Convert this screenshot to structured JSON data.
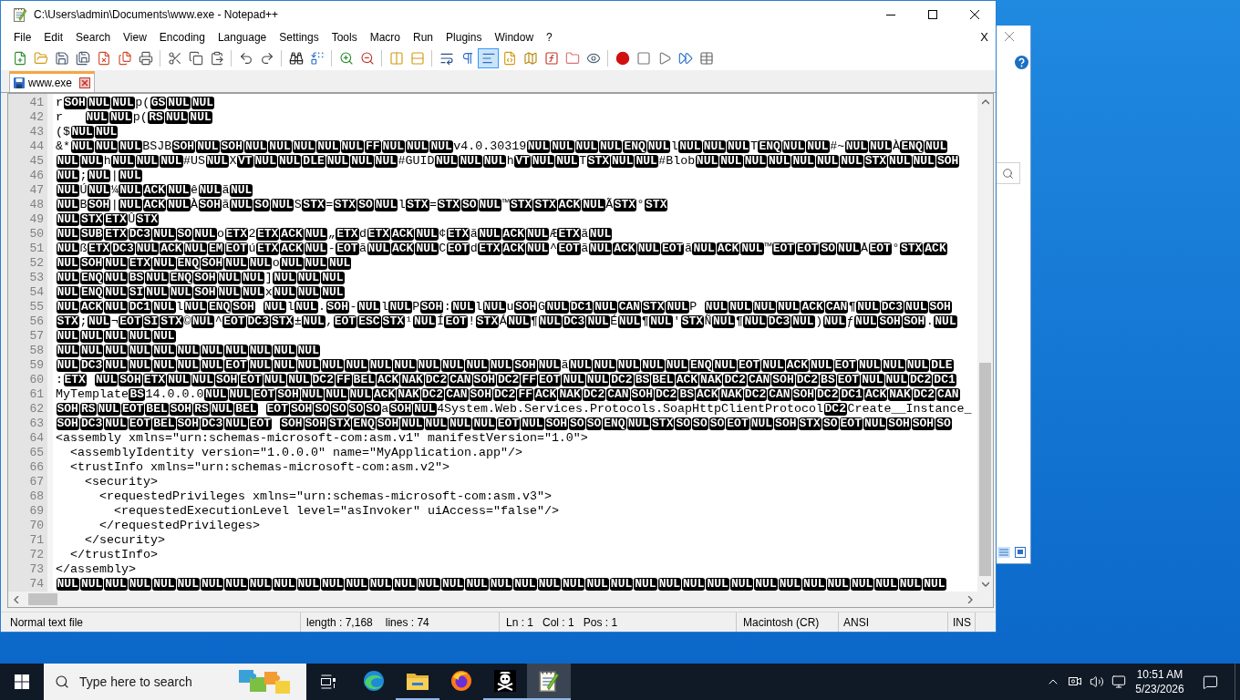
{
  "window": {
    "title": "C:\\Users\\admin\\Documents\\www.exe - Notepad++"
  },
  "menu": {
    "items": [
      "File",
      "Edit",
      "Search",
      "View",
      "Encoding",
      "Language",
      "Settings",
      "Tools",
      "Macro",
      "Run",
      "Plugins",
      "Window",
      "?"
    ],
    "close_document": "X"
  },
  "toolbar": {
    "buttons": [
      {
        "pressed": false
      },
      {
        "pressed": false
      },
      {
        "pressed": false
      },
      {
        "pressed": false
      },
      {
        "pressed": false
      },
      {
        "pressed": false
      },
      {
        "pressed": false
      },
      {
        "pressed": false
      },
      {
        "pressed": false
      },
      {
        "pressed": false
      },
      {
        "pressed": false
      },
      {
        "pressed": false
      },
      {
        "pressed": false
      },
      {
        "pressed": false
      },
      {
        "pressed": false
      },
      {
        "pressed": false
      },
      {
        "pressed": false
      },
      {
        "pressed": false
      },
      {
        "pressed": false
      },
      {
        "pressed": false
      },
      {
        "pressed": true
      },
      {
        "pressed": false
      },
      {
        "pressed": false
      },
      {
        "pressed": false
      },
      {
        "pressed": false
      },
      {
        "pressed": false
      },
      {
        "pressed": false
      },
      {
        "pressed": false
      },
      {
        "pressed": false
      },
      {
        "pressed": false
      },
      {
        "pressed": false
      }
    ]
  },
  "tabs": [
    {
      "label": "www.exe",
      "selected": true,
      "modified": false
    }
  ],
  "editor": {
    "lines": [
      {
        "number": "41",
        "parts": [
          {
            "kind": "text",
            "text": "r"
          },
          {
            "kind": "ctrl",
            "codes": [
              "SOH",
              "NUL",
              "NUL"
            ]
          },
          {
            "kind": "text",
            "text": "p("
          },
          {
            "kind": "ctrl",
            "codes": [
              "GS",
              "NUL",
              "NUL"
            ]
          }
        ]
      },
      {
        "number": "42",
        "parts": [
          {
            "kind": "text",
            "text": "r   "
          },
          {
            "kind": "ctrl",
            "codes": [
              "NUL",
              "NUL"
            ]
          },
          {
            "kind": "text",
            "text": "p("
          },
          {
            "kind": "ctrl",
            "codes": [
              "RS",
              "NUL",
              "NUL"
            ]
          }
        ]
      },
      {
        "number": "43",
        "parts": [
          {
            "kind": "text",
            "text": "($"
          },
          {
            "kind": "ctrl",
            "codes": [
              "NUL",
              "NUL"
            ]
          }
        ]
      },
      {
        "number": "44",
        "parts": [
          {
            "kind": "text",
            "text": "&*"
          },
          {
            "kind": "ctrl",
            "codes": [
              "NUL",
              "NUL",
              "NUL"
            ]
          },
          {
            "kind": "text",
            "text": "BSJB"
          },
          {
            "kind": "ctrl",
            "codes": [
              "SOH",
              "NUL",
              "SOH",
              "NUL",
              "NUL",
              "NUL",
              "NUL",
              "NUL",
              "FF",
              "NUL",
              "NUL",
              "NUL"
            ]
          },
          {
            "kind": "text",
            "text": "v4.0.30319"
          },
          {
            "kind": "ctrl",
            "codes": [
              "NUL",
              "NUL",
              "NUL",
              "NUL",
              "ENQ",
              "NUL"
            ]
          },
          {
            "kind": "text",
            "text": "l"
          },
          {
            "kind": "ctrl",
            "codes": [
              "NUL",
              "NUL",
              "NUL"
            ]
          },
          {
            "kind": "text",
            "text": "T"
          },
          {
            "kind": "ctrl",
            "codes": [
              "ENQ",
              "NUL",
              "NUL"
            ]
          },
          {
            "kind": "text",
            "text": "#~"
          },
          {
            "kind": "ctrl",
            "codes": [
              "NUL",
              "NUL"
            ]
          },
          {
            "kind": "text",
            "text": "À"
          },
          {
            "kind": "ctrl",
            "codes": [
              "ENQ",
              "NUL"
            ]
          }
        ]
      },
      {
        "number": "45",
        "parts": [
          {
            "kind": "ctrl",
            "codes": [
              "NUL",
              "NUL"
            ]
          },
          {
            "kind": "text",
            "text": "h"
          },
          {
            "kind": "ctrl",
            "codes": [
              "NUL",
              "NUL",
              "NUL"
            ]
          },
          {
            "kind": "text",
            "text": "#US"
          },
          {
            "kind": "ctrl",
            "codes": [
              "NUL"
            ]
          },
          {
            "kind": "text",
            "text": "X"
          },
          {
            "kind": "ctrl",
            "codes": [
              "VT",
              "NUL",
              "NUL",
              "DLE",
              "NUL",
              "NUL",
              "NUL"
            ]
          },
          {
            "kind": "text",
            "text": "#GUID"
          },
          {
            "kind": "ctrl",
            "codes": [
              "NUL",
              "NUL",
              "NUL"
            ]
          },
          {
            "kind": "text",
            "text": "h"
          },
          {
            "kind": "ctrl",
            "codes": [
              "VT",
              "NUL",
              "NUL"
            ]
          },
          {
            "kind": "text",
            "text": "T"
          },
          {
            "kind": "ctrl",
            "codes": [
              "STX",
              "NUL",
              "NUL"
            ]
          },
          {
            "kind": "text",
            "text": "#Blob"
          },
          {
            "kind": "ctrl",
            "codes": [
              "NUL",
              "NUL",
              "NUL",
              "NUL",
              "NUL",
              "NUL",
              "NUL",
              "STX",
              "NUL",
              "NUL",
              "SOH"
            ]
          }
        ]
      },
      {
        "number": "46",
        "parts": [
          {
            "kind": "ctrl",
            "codes": [
              "NUL"
            ]
          },
          {
            "kind": "text",
            "text": ";"
          },
          {
            "kind": "ctrl",
            "codes": [
              "NUL"
            ]
          },
          {
            "kind": "text",
            "text": "|"
          },
          {
            "kind": "ctrl",
            "codes": [
              "NUL"
            ]
          }
        ]
      },
      {
        "number": "47",
        "parts": [
          {
            "kind": "ctrl",
            "codes": [
              "NUL"
            ]
          },
          {
            "kind": "text",
            "text": "Ú"
          },
          {
            "kind": "ctrl",
            "codes": [
              "NUL"
            ]
          },
          {
            "kind": "text",
            "text": "¼"
          },
          {
            "kind": "ctrl",
            "codes": [
              "NUL",
              "ACK",
              "NUL"
            ]
          },
          {
            "kind": "text",
            "text": "ê"
          },
          {
            "kind": "ctrl",
            "codes": [
              "NUL"
            ]
          },
          {
            "kind": "text",
            "text": "ã"
          },
          {
            "kind": "ctrl",
            "codes": [
              "NUL"
            ]
          }
        ]
      },
      {
        "number": "48",
        "parts": [
          {
            "kind": "ctrl",
            "codes": [
              "NUL"
            ]
          },
          {
            "kind": "text",
            "text": "B"
          },
          {
            "kind": "ctrl",
            "codes": [
              "SOH"
            ]
          },
          {
            "kind": "text",
            "text": "|"
          },
          {
            "kind": "ctrl",
            "codes": [
              "NUL",
              "ACK",
              "NUL"
            ]
          },
          {
            "kind": "text",
            "text": "À"
          },
          {
            "kind": "ctrl",
            "codes": [
              "SOH"
            ]
          },
          {
            "kind": "text",
            "text": "ã"
          },
          {
            "kind": "ctrl",
            "codes": [
              "NUL",
              "SO",
              "NUL"
            ]
          },
          {
            "kind": "text",
            "text": "S"
          },
          {
            "kind": "ctrl",
            "codes": [
              "STX"
            ]
          },
          {
            "kind": "text",
            "text": "="
          },
          {
            "kind": "ctrl",
            "codes": [
              "STX",
              "SO",
              "NUL"
            ]
          },
          {
            "kind": "text",
            "text": "l"
          },
          {
            "kind": "ctrl",
            "codes": [
              "STX"
            ]
          },
          {
            "kind": "text",
            "text": "="
          },
          {
            "kind": "ctrl",
            "codes": [
              "STX",
              "SO",
              "NUL"
            ]
          },
          {
            "kind": "text",
            "text": "™"
          },
          {
            "kind": "ctrl",
            "codes": [
              "STX",
              "STX",
              "ACK",
              "NUL"
            ]
          },
          {
            "kind": "text",
            "text": "Ã"
          },
          {
            "kind": "ctrl",
            "codes": [
              "STX"
            ]
          },
          {
            "kind": "text",
            "text": "°"
          },
          {
            "kind": "ctrl",
            "codes": [
              "STX"
            ]
          }
        ]
      },
      {
        "number": "49",
        "parts": [
          {
            "kind": "ctrl",
            "codes": [
              "NUL",
              "STX",
              "ETX"
            ]
          },
          {
            "kind": "text",
            "text": "Û"
          },
          {
            "kind": "ctrl",
            "codes": [
              "STX"
            ]
          }
        ]
      },
      {
        "number": "50",
        "parts": [
          {
            "kind": "ctrl",
            "codes": [
              "NUL",
              "SUB",
              "ETX",
              "DC3",
              "NUL",
              "SO",
              "NUL"
            ]
          },
          {
            "kind": "text",
            "text": "o"
          },
          {
            "kind": "ctrl",
            "codes": [
              "ETX"
            ]
          },
          {
            "kind": "text",
            "text": "2"
          },
          {
            "kind": "ctrl",
            "codes": [
              "ETX",
              "ACK",
              "NUL"
            ]
          },
          {
            "kind": "text",
            "text": "„"
          },
          {
            "kind": "ctrl",
            "codes": [
              "ETX"
            ]
          },
          {
            "kind": "text",
            "text": "d"
          },
          {
            "kind": "ctrl",
            "codes": [
              "ETX",
              "ACK",
              "NUL"
            ]
          },
          {
            "kind": "text",
            "text": "¢"
          },
          {
            "kind": "ctrl",
            "codes": [
              "ETX"
            ]
          },
          {
            "kind": "text",
            "text": "ã"
          },
          {
            "kind": "ctrl",
            "codes": [
              "NUL",
              "ACK",
              "NUL"
            ]
          },
          {
            "kind": "text",
            "text": "Æ"
          },
          {
            "kind": "ctrl",
            "codes": [
              "ETX"
            ]
          },
          {
            "kind": "text",
            "text": "ã"
          },
          {
            "kind": "ctrl",
            "codes": [
              "NUL"
            ]
          }
        ]
      },
      {
        "number": "51",
        "parts": [
          {
            "kind": "ctrl",
            "codes": [
              "NUL"
            ]
          },
          {
            "kind": "text",
            "text": "ß"
          },
          {
            "kind": "ctrl",
            "codes": [
              "ETX",
              "DC3",
              "NUL",
              "ACK",
              "NUL",
              "EM",
              "EOT"
            ]
          },
          {
            "kind": "text",
            "text": "ú"
          },
          {
            "kind": "ctrl",
            "codes": [
              "ETX",
              "ACK",
              "NUL"
            ]
          },
          {
            "kind": "text",
            "text": "-"
          },
          {
            "kind": "ctrl",
            "codes": [
              "EOT"
            ]
          },
          {
            "kind": "text",
            "text": "ã"
          },
          {
            "kind": "ctrl",
            "codes": [
              "NUL",
              "ACK",
              "NUL"
            ]
          },
          {
            "kind": "text",
            "text": "C"
          },
          {
            "kind": "ctrl",
            "codes": [
              "EOT"
            ]
          },
          {
            "kind": "text",
            "text": "d"
          },
          {
            "kind": "ctrl",
            "codes": [
              "ETX",
              "ACK",
              "NUL"
            ]
          },
          {
            "kind": "text",
            "text": "^"
          },
          {
            "kind": "ctrl",
            "codes": [
              "EOT"
            ]
          },
          {
            "kind": "text",
            "text": "ã"
          },
          {
            "kind": "ctrl",
            "codes": [
              "NUL",
              "ACK",
              "NUL",
              "EOT"
            ]
          },
          {
            "kind": "text",
            "text": "ã"
          },
          {
            "kind": "ctrl",
            "codes": [
              "NUL",
              "ACK",
              "NUL"
            ]
          },
          {
            "kind": "text",
            "text": "™"
          },
          {
            "kind": "ctrl",
            "codes": [
              "EOT",
              "EOT",
              "SO",
              "NUL"
            ]
          },
          {
            "kind": "text",
            "text": "Å"
          },
          {
            "kind": "ctrl",
            "codes": [
              "EOT"
            ]
          },
          {
            "kind": "text",
            "text": "°"
          },
          {
            "kind": "ctrl",
            "codes": [
              "STX",
              "ACK"
            ]
          }
        ]
      },
      {
        "number": "52",
        "parts": [
          {
            "kind": "ctrl",
            "codes": [
              "NUL",
              "SOH",
              "NUL",
              "ETX",
              "NUL",
              "ENQ",
              "SOH",
              "NUL",
              "NUL"
            ]
          },
          {
            "kind": "text",
            "text": "o"
          },
          {
            "kind": "ctrl",
            "codes": [
              "NUL",
              "NUL",
              "NUL"
            ]
          }
        ]
      },
      {
        "number": "53",
        "parts": [
          {
            "kind": "ctrl",
            "codes": [
              "NUL",
              "ENQ",
              "NUL",
              "BS",
              "NUL",
              "ENQ",
              "SOH",
              "NUL",
              "NUL"
            ]
          },
          {
            "kind": "text",
            "text": "]"
          },
          {
            "kind": "ctrl",
            "codes": [
              "NUL",
              "NUL",
              "NUL"
            ]
          }
        ]
      },
      {
        "number": "54",
        "parts": [
          {
            "kind": "ctrl",
            "codes": [
              "NUL",
              "ENQ",
              "NUL",
              "SI",
              "NUL",
              "NUL",
              "SOH",
              "NUL",
              "NUL"
            ]
          },
          {
            "kind": "text",
            "text": "x"
          },
          {
            "kind": "ctrl",
            "codes": [
              "NUL",
              "NUL",
              "NUL"
            ]
          }
        ]
      },
      {
        "number": "55",
        "parts": [
          {
            "kind": "ctrl",
            "codes": [
              "NUL",
              "ACK",
              "NUL",
              "DC1",
              "NUL"
            ]
          },
          {
            "kind": "text",
            "text": "l"
          },
          {
            "kind": "ctrl",
            "codes": [
              "NUL",
              "ENQ",
              "SOH"
            ]
          },
          {
            "kind": "space"
          },
          {
            "kind": "ctrl",
            "codes": [
              "NUL"
            ]
          },
          {
            "kind": "text",
            "text": "l"
          },
          {
            "kind": "ctrl",
            "codes": [
              "NUL"
            ]
          },
          {
            "kind": "text",
            "text": "."
          },
          {
            "kind": "ctrl",
            "codes": [
              "SOH"
            ]
          },
          {
            "kind": "text",
            "text": "-"
          },
          {
            "kind": "ctrl",
            "codes": [
              "NUL"
            ]
          },
          {
            "kind": "text",
            "text": "l"
          },
          {
            "kind": "ctrl",
            "codes": [
              "NUL"
            ]
          },
          {
            "kind": "text",
            "text": "P"
          },
          {
            "kind": "ctrl",
            "codes": [
              "SOH"
            ]
          },
          {
            "kind": "text",
            "text": ":"
          },
          {
            "kind": "ctrl",
            "codes": [
              "NUL"
            ]
          },
          {
            "kind": "text",
            "text": "l"
          },
          {
            "kind": "ctrl",
            "codes": [
              "NUL"
            ]
          },
          {
            "kind": "text",
            "text": "u"
          },
          {
            "kind": "ctrl",
            "codes": [
              "SOH"
            ]
          },
          {
            "kind": "text",
            "text": "G"
          },
          {
            "kind": "ctrl",
            "codes": [
              "NUL",
              "DC1",
              "NUL",
              "CAN",
              "STX",
              "NUL"
            ]
          },
          {
            "kind": "text",
            "text": "P "
          },
          {
            "kind": "ctrl",
            "codes": [
              "NUL",
              "NUL",
              "NUL",
              "NUL",
              "ACK",
              "CAN"
            ]
          },
          {
            "kind": "text",
            "text": "¶"
          },
          {
            "kind": "ctrl",
            "codes": [
              "NUL",
              "DC3",
              "NUL",
              "SOH"
            ]
          }
        ]
      },
      {
        "number": "56",
        "parts": [
          {
            "kind": "ctrl",
            "codes": [
              "STX"
            ]
          },
          {
            "kind": "text",
            "text": ";"
          },
          {
            "kind": "ctrl",
            "codes": [
              "NUL"
            ]
          },
          {
            "kind": "text",
            "text": "¬"
          },
          {
            "kind": "ctrl",
            "codes": [
              "EOT",
              "SI",
              "STX"
            ]
          },
          {
            "kind": "text",
            "text": "©"
          },
          {
            "kind": "ctrl",
            "codes": [
              "NUL"
            ]
          },
          {
            "kind": "text",
            "text": "^"
          },
          {
            "kind": "ctrl",
            "codes": [
              "EOT",
              "DC3",
              "STX"
            ]
          },
          {
            "kind": "text",
            "text": "±"
          },
          {
            "kind": "ctrl",
            "codes": [
              "NUL"
            ]
          },
          {
            "kind": "text",
            "text": ","
          },
          {
            "kind": "ctrl",
            "codes": [
              "EOT",
              "ESC",
              "STX"
            ]
          },
          {
            "kind": "text",
            "text": "¹"
          },
          {
            "kind": "ctrl",
            "codes": [
              "NUL"
            ]
          },
          {
            "kind": "text",
            "text": "Í"
          },
          {
            "kind": "ctrl",
            "codes": [
              "EOT"
            ]
          },
          {
            "kind": "text",
            "text": "!"
          },
          {
            "kind": "ctrl",
            "codes": [
              "STX"
            ]
          },
          {
            "kind": "text",
            "text": "Á"
          },
          {
            "kind": "ctrl",
            "codes": [
              "NUL"
            ]
          },
          {
            "kind": "text",
            "text": "¶"
          },
          {
            "kind": "ctrl",
            "codes": [
              "NUL",
              "DC3",
              "NUL"
            ]
          },
          {
            "kind": "text",
            "text": "É"
          },
          {
            "kind": "ctrl",
            "codes": [
              "NUL"
            ]
          },
          {
            "kind": "text",
            "text": "¶"
          },
          {
            "kind": "ctrl",
            "codes": [
              "NUL"
            ]
          },
          {
            "kind": "text",
            "text": "'"
          },
          {
            "kind": "ctrl",
            "codes": [
              "STX"
            ]
          },
          {
            "kind": "text",
            "text": "Ñ"
          },
          {
            "kind": "ctrl",
            "codes": [
              "NUL"
            ]
          },
          {
            "kind": "text",
            "text": "¶"
          },
          {
            "kind": "ctrl",
            "codes": [
              "NUL",
              "DC3",
              "NUL"
            ]
          },
          {
            "kind": "text",
            "text": ")"
          },
          {
            "kind": "ctrl",
            "codes": [
              "NUL"
            ]
          },
          {
            "kind": "text",
            "text": "ƒ"
          },
          {
            "kind": "ctrl",
            "codes": [
              "NUL",
              "SOH",
              "SOH"
            ]
          },
          {
            "kind": "text",
            "text": "."
          },
          {
            "kind": "ctrl",
            "codes": [
              "NUL"
            ]
          }
        ]
      },
      {
        "number": "57",
        "parts": [
          {
            "kind": "ctrl",
            "codes": [
              "NUL",
              "NUL",
              "NUL",
              "NUL",
              "NUL"
            ]
          }
        ]
      },
      {
        "number": "58",
        "parts": [
          {
            "kind": "ctrl",
            "codes": [
              "NUL",
              "NUL",
              "NUL",
              "NUL",
              "NUL",
              "NUL",
              "NUL",
              "NUL",
              "NUL",
              "NUL",
              "NUL"
            ]
          }
        ]
      },
      {
        "number": "59",
        "parts": [
          {
            "kind": "ctrl",
            "codes": [
              "NUL",
              "DC3",
              "NUL",
              "NUL",
              "NUL",
              "NUL",
              "NUL",
              "EOT",
              "NUL",
              "NUL",
              "NUL",
              "NUL",
              "NUL",
              "NUL",
              "NUL",
              "NUL",
              "NUL",
              "NUL",
              "NUL",
              "SOH",
              "NUL"
            ]
          },
          {
            "kind": "text",
            "text": "ã"
          },
          {
            "kind": "ctrl",
            "codes": [
              "NUL",
              "NUL",
              "NUL",
              "NUL",
              "NUL",
              "ENQ",
              "NUL",
              "EOT",
              "NUL",
              "ACK",
              "NUL",
              "EOT",
              "NUL",
              "NUL",
              "NUL",
              "DLE"
            ]
          }
        ]
      },
      {
        "number": "60",
        "parts": [
          {
            "kind": "text",
            "text": ":"
          },
          {
            "kind": "ctrl",
            "codes": [
              "ETX"
            ]
          },
          {
            "kind": "space"
          },
          {
            "kind": "ctrl",
            "codes": [
              "NUL",
              "SOH",
              "ETX",
              "NUL",
              "NUL",
              "SOH",
              "EOT",
              "NUL",
              "NUL",
              "DC2",
              "FF",
              "BEL",
              "ACK",
              "NAK",
              "DC2",
              "CAN",
              "SOH",
              "DC2",
              "FF",
              "EOT",
              "NUL",
              "NUL",
              "DC2",
              "BS",
              "BEL",
              "ACK",
              "NAK",
              "DC2",
              "CAN",
              "SOH",
              "DC2",
              "BS",
              "EOT",
              "NUL",
              "NUL",
              "DC2",
              "DC1"
            ]
          }
        ]
      },
      {
        "number": "61",
        "parts": [
          {
            "kind": "text",
            "text": "MyTemplate"
          },
          {
            "kind": "ctrl",
            "codes": [
              "BS"
            ]
          },
          {
            "kind": "text",
            "text": "14.0.0.0"
          },
          {
            "kind": "ctrl",
            "codes": [
              "NUL",
              "NUL",
              "EOT",
              "SOH",
              "NUL",
              "NUL",
              "NUL",
              "ACK",
              "NAK",
              "DC2",
              "CAN",
              "SOH",
              "DC2",
              "FF",
              "ACK",
              "NAK",
              "DC2",
              "CAN",
              "SOH",
              "DC2",
              "BS",
              "ACK",
              "NAK",
              "DC2",
              "CAN",
              "SOH",
              "DC2",
              "DC1",
              "ACK",
              "NAK",
              "DC2",
              "CAN"
            ]
          }
        ]
      },
      {
        "number": "62",
        "parts": [
          {
            "kind": "ctrl",
            "codes": [
              "SOH",
              "RS",
              "NUL",
              "EOT",
              "BEL",
              "SOH",
              "RS",
              "NUL",
              "BEL"
            ]
          },
          {
            "kind": "space"
          },
          {
            "kind": "ctrl",
            "codes": [
              "EOT",
              "SOH",
              "SO",
              "SO",
              "SO",
              "SO"
            ]
          },
          {
            "kind": "text",
            "text": "a"
          },
          {
            "kind": "ctrl",
            "codes": [
              "SOH",
              "NUL"
            ]
          },
          {
            "kind": "text",
            "text": "4System.Web.Services.Protocols.SoapHttpClientProtocol"
          },
          {
            "kind": "ctrl",
            "codes": [
              "DC2"
            ]
          },
          {
            "kind": "text",
            "text": "Create__Instance_"
          }
        ]
      },
      {
        "number": "63",
        "parts": [
          {
            "kind": "ctrl",
            "codes": [
              "SOH",
              "DC3",
              "NUL",
              "EOT",
              "BEL",
              "SOH",
              "DC3",
              "NUL",
              "EOT"
            ]
          },
          {
            "kind": "space"
          },
          {
            "kind": "ctrl",
            "codes": [
              "SOH",
              "SOH",
              "STX",
              "ENQ",
              "SOH",
              "NUL",
              "NUL",
              "NUL",
              "NUL",
              "EOT",
              "NUL",
              "SOH",
              "SO",
              "SO",
              "ENQ",
              "NUL",
              "STX",
              "SO",
              "SO",
              "SO",
              "EOT",
              "NUL",
              "SOH",
              "STX",
              "SO",
              "EOT",
              "NUL",
              "SOH",
              "SOH",
              "SO"
            ]
          }
        ]
      },
      {
        "number": "64",
        "parts": [
          {
            "kind": "text",
            "text": "<assembly xmlns=\"urn:schemas-microsoft-com:asm.v1\" manifestVersion=\"1.0\">"
          }
        ]
      },
      {
        "number": "65",
        "parts": [
          {
            "kind": "text",
            "text": "  <assemblyIdentity version=\"1.0.0.0\" name=\"MyApplication.app\"/>"
          }
        ]
      },
      {
        "number": "66",
        "parts": [
          {
            "kind": "text",
            "text": "  <trustInfo xmlns=\"urn:schemas-microsoft-com:asm.v2\">"
          }
        ]
      },
      {
        "number": "67",
        "parts": [
          {
            "kind": "text",
            "text": "    <security>"
          }
        ]
      },
      {
        "number": "68",
        "parts": [
          {
            "kind": "text",
            "text": "      <requestedPrivileges xmlns=\"urn:schemas-microsoft-com:asm.v3\">"
          }
        ]
      },
      {
        "number": "69",
        "parts": [
          {
            "kind": "text",
            "text": "        <requestedExecutionLevel level=\"asInvoker\" uiAccess=\"false\"/>"
          }
        ]
      },
      {
        "number": "70",
        "parts": [
          {
            "kind": "text",
            "text": "      </requestedPrivileges>"
          }
        ]
      },
      {
        "number": "71",
        "parts": [
          {
            "kind": "text",
            "text": "    </security>"
          }
        ]
      },
      {
        "number": "72",
        "parts": [
          {
            "kind": "text",
            "text": "  </trustInfo>"
          }
        ]
      },
      {
        "number": "73",
        "parts": [
          {
            "kind": "text",
            "text": "</assembly>"
          }
        ]
      },
      {
        "number": "74",
        "parts": [
          {
            "kind": "ctrl",
            "codes": [
              "NUL",
              "NUL",
              "NUL",
              "NUL",
              "NUL",
              "NUL",
              "NUL",
              "NUL",
              "NUL",
              "NUL",
              "NUL",
              "NUL",
              "NUL",
              "NUL",
              "NUL",
              "NUL",
              "NUL",
              "NUL",
              "NUL",
              "NUL",
              "NUL",
              "NUL",
              "NUL",
              "NUL",
              "NUL",
              "NUL",
              "NUL",
              "NUL",
              "NUL",
              "NUL",
              "NUL",
              "NUL",
              "NUL",
              "NUL",
              "NUL",
              "NUL",
              "NUL"
            ]
          }
        ]
      }
    ]
  },
  "status_bar": {
    "file_type": "Normal text file",
    "length": "length : 7,168",
    "lines": "lines : 74",
    "ln": "Ln : 1",
    "col": "Col : 1",
    "pos": "Pos : 1",
    "eol": "Macintosh (CR)",
    "encoding": "ANSI",
    "mode": "INS"
  },
  "taskbar": {
    "search": {
      "placeholder": "Type here to search"
    },
    "apps": [
      {
        "running": false,
        "selected": false
      },
      {
        "running": true,
        "selected": false
      },
      {
        "running": false,
        "selected": false
      },
      {
        "running": true,
        "selected": false
      },
      {
        "running": true,
        "selected": true
      }
    ],
    "time": "10:51 AM",
    "date": "5/23/2026"
  }
}
